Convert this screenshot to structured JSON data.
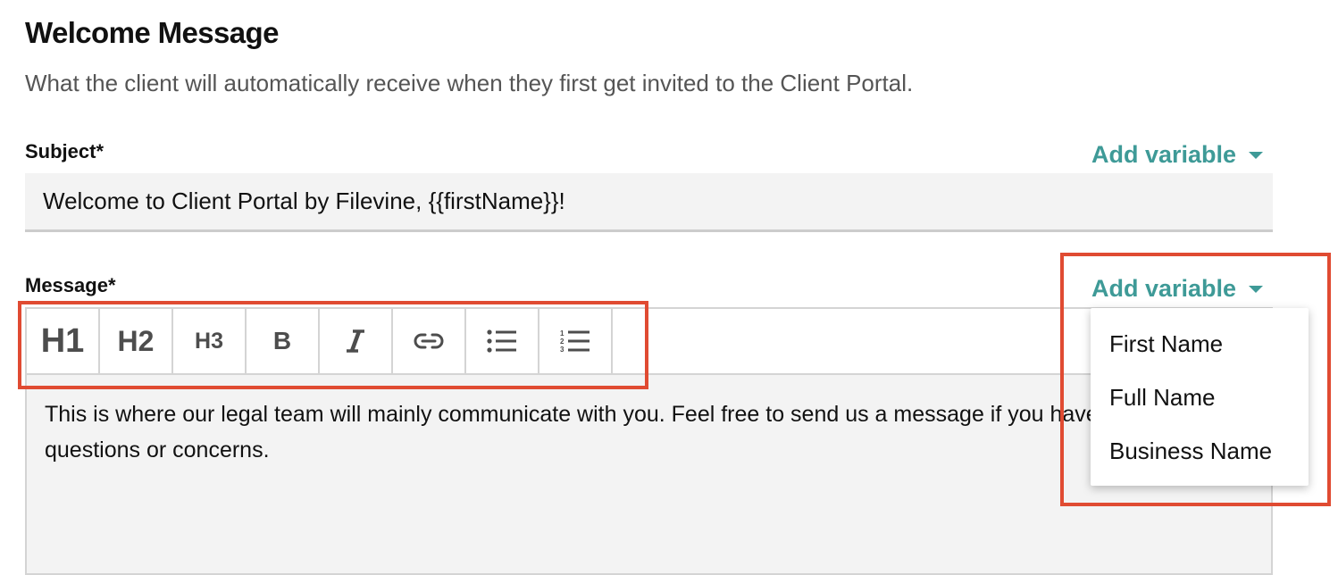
{
  "header": {
    "title": "Welcome Message",
    "description": "What the client will automatically receive when they first get invited to the Client Portal."
  },
  "subject": {
    "label": "Subject*",
    "add_variable_label": "Add variable",
    "value": "Welcome to Client Portal by Filevine, {{firstName}}!"
  },
  "message": {
    "label": "Message*",
    "add_variable_label": "Add variable",
    "body_text": "This is where our legal team will mainly communicate with you. Feel free to send us a message if you have any questions or concerns."
  },
  "toolbar": {
    "h1_label": "H1",
    "h2_label": "H2",
    "h3_label": "H3",
    "bold_label": "B",
    "buttons": [
      "heading-1",
      "heading-2",
      "heading-3",
      "bold",
      "italic",
      "link",
      "bulleted-list",
      "numbered-list"
    ]
  },
  "variable_dropdown": {
    "items": [
      "First Name",
      "Full Name",
      "Business Name"
    ]
  },
  "colors": {
    "accent": "#3e9a97",
    "highlight_box": "#e04b32",
    "field_background": "#f3f3f3"
  }
}
